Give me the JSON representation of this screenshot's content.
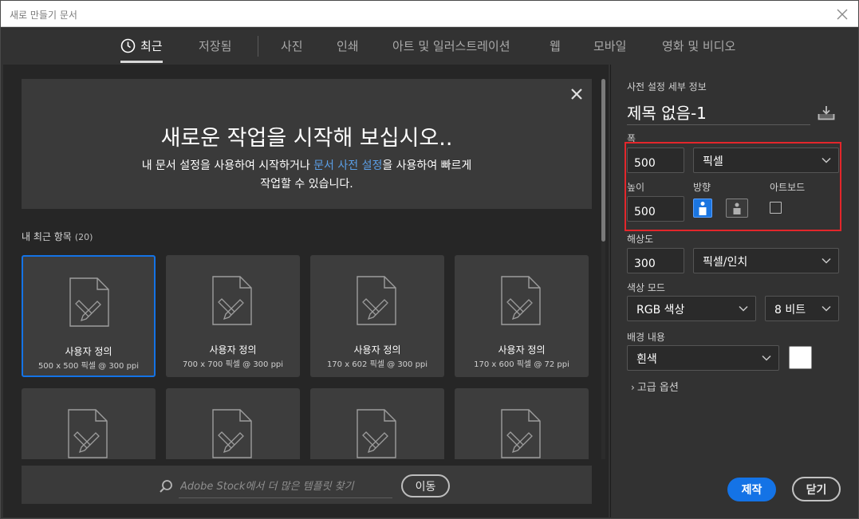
{
  "window": {
    "title": "새로 만들기 문서"
  },
  "tabs": [
    {
      "label": "최근",
      "active": true
    },
    {
      "label": "저장됨"
    },
    {
      "label": "사진"
    },
    {
      "label": "인쇄"
    },
    {
      "label": "아트 및 일러스트레이션"
    },
    {
      "label": "웹"
    },
    {
      "label": "모바일"
    },
    {
      "label": "영화 및 비디오"
    }
  ],
  "hero": {
    "heading": "새로운 작업을 시작해 보십시오..",
    "text_before": "내 문서 설정을 사용하여 시작하거나 ",
    "link": "문서 사전 설정",
    "text_after": "을 사용하여 빠르게",
    "line2": "작업할 수 있습니다."
  },
  "recent": {
    "label": "내 최근 항목",
    "count": "(20)",
    "items": [
      {
        "name": "사용자 정의",
        "dims": "500 x 500 픽셀 @ 300 ppi",
        "selected": true
      },
      {
        "name": "사용자 정의",
        "dims": "700 x 700 픽셀 @ 300 ppi"
      },
      {
        "name": "사용자 정의",
        "dims": "170 x 602 픽셀 @ 300 ppi"
      },
      {
        "name": "사용자 정의",
        "dims": "170 x 600 픽셀 @ 72 ppi"
      },
      {
        "name": "",
        "dims": ""
      },
      {
        "name": "",
        "dims": ""
      },
      {
        "name": "",
        "dims": ""
      },
      {
        "name": "",
        "dims": ""
      }
    ]
  },
  "stock": {
    "placeholder": "Adobe Stock에서 더 많은 템플릿 찾기",
    "go_label": "이동"
  },
  "details": {
    "section_title": "사전 설정 세부 정보",
    "doc_name": "제목 없음-1",
    "width_label": "폭",
    "width_value": "500",
    "unit": "픽셀",
    "height_label": "높이",
    "height_value": "500",
    "orientation_label": "방향",
    "artboard_label": "아트보드",
    "resolution_label": "해상도",
    "resolution_value": "300",
    "resolution_unit": "픽셀/인치",
    "color_mode_label": "색상 모드",
    "color_mode": "RGB 색상",
    "bit_depth": "8 비트",
    "background_label": "배경 내용",
    "background": "흰색",
    "background_color": "#ffffff",
    "advanced": "고급 옵션",
    "create_label": "제작",
    "close_label": "닫기"
  },
  "colors": {
    "accent": "#1473e6",
    "highlight": "#e3262b"
  }
}
